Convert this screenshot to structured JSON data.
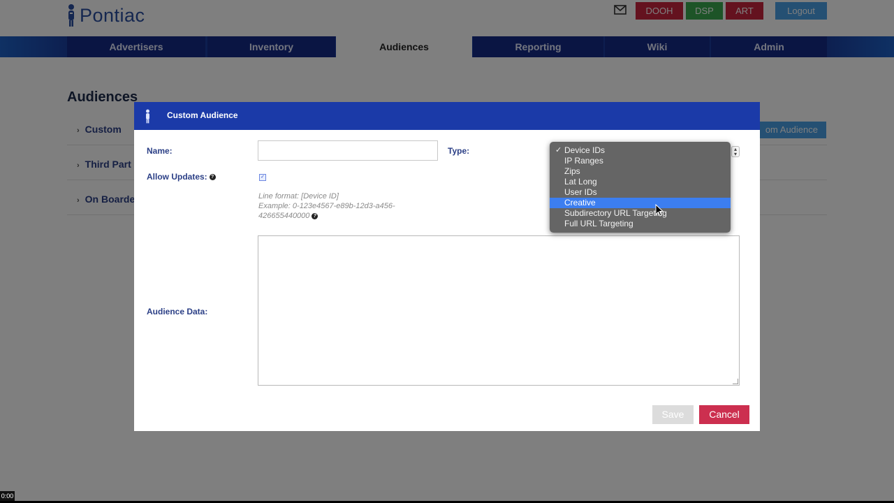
{
  "header": {
    "logo_text": "Pontiac",
    "buttons": [
      {
        "label": "DOOH",
        "color": "#c8243f"
      },
      {
        "label": "DSP",
        "color": "#3aa84e"
      },
      {
        "label": "ART",
        "color": "#c8243f"
      },
      {
        "label": "Logout",
        "color": "#4aa0e6"
      }
    ]
  },
  "nav": {
    "tabs": [
      {
        "label": "Advertisers",
        "active": false
      },
      {
        "label": "Inventory",
        "active": false
      },
      {
        "label": "Audiences",
        "active": true
      },
      {
        "label": "Reporting",
        "active": false
      },
      {
        "label": "Wiki",
        "active": false
      },
      {
        "label": "Admin",
        "active": false
      }
    ]
  },
  "page": {
    "title": "Audiences",
    "side_items": [
      "Custom",
      "Third Part",
      "On Boarde"
    ],
    "right_button": "om Audience"
  },
  "modal": {
    "title": "Custom Audience",
    "name_label": "Name:",
    "name_value": "",
    "type_label": "Type:",
    "allow_updates_label": "Allow Updates:",
    "allow_updates_checked": true,
    "hint_line1": "Line format: [Device ID]",
    "hint_line2": "Example: 0-123e4567-e89b-12d3-a456-",
    "hint_line3": "426655440000",
    "audience_data_label": "Audience Data:",
    "audience_data_value": "",
    "save_label": "Save",
    "cancel_label": "Cancel"
  },
  "type_dropdown": {
    "selected": "Device IDs",
    "highlighted": "Creative",
    "options": [
      "Device IDs",
      "IP Ranges",
      "Zips",
      "Lat Long",
      "User IDs",
      "Creative",
      "Subdirectory URL Targeting",
      "Full URL Targeting"
    ]
  },
  "video_timestamp": "0:00",
  "colors": {
    "modal_header": "#1b3aa8",
    "nav_tab": "#142a86",
    "cancel": "#cc2f4f",
    "highlight": "#3c7ef0"
  }
}
